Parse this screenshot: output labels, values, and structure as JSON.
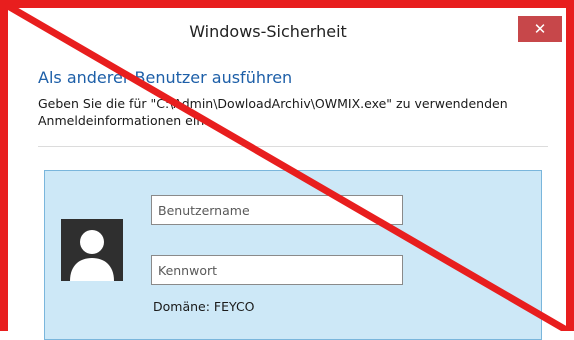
{
  "window": {
    "title": "Windows-Sicherheit",
    "close_symbol": "✕",
    "frame_color": "#e81e1e"
  },
  "dialog": {
    "heading": "Als anderer Benutzer ausführen",
    "description": "Geben Sie die für \"C:\\Admin\\DowloadArchiv\\OWMIX.exe\" zu verwendenden Anmeldeinformationen ein."
  },
  "credentials": {
    "username_placeholder": "Benutzername",
    "password_placeholder": "Kennwort",
    "domain_label": "Domäne: FEYCO",
    "avatar_icon": "user-silhouette-icon"
  },
  "colors": {
    "accent": "#1d5fa8",
    "panel_bg": "#cde8f7",
    "close_bg": "#c7474a",
    "strike_line": "#e81e1e"
  }
}
